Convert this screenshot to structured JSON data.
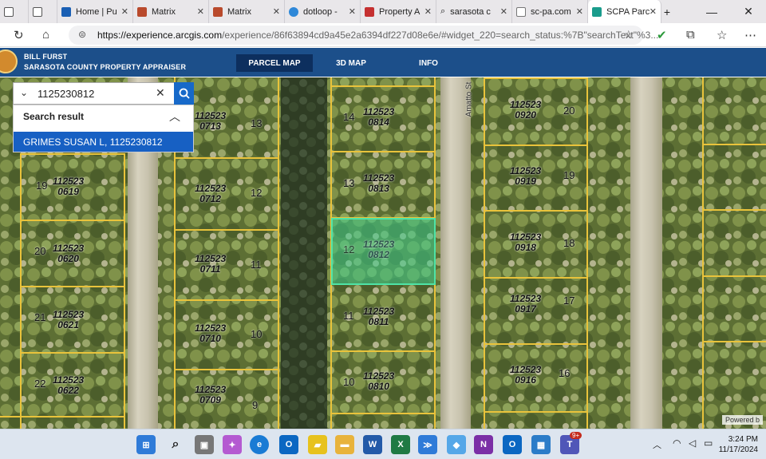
{
  "browser": {
    "tabs": [
      {
        "label": "",
        "color": "#6f6f6f"
      },
      {
        "label": "",
        "color": "#555"
      },
      {
        "label": "Home | Pu",
        "color": "#1a5fb4"
      },
      {
        "label": "Matrix",
        "color": "#b94a2c"
      },
      {
        "label": "Matrix",
        "color": "#b94a2c"
      },
      {
        "label": "dotloop - ",
        "color": "#2e88d8"
      },
      {
        "label": "Property A",
        "color": "#c53030"
      },
      {
        "label": "sarasota c",
        "color": "#555"
      },
      {
        "label": "sc-pa.com",
        "color": "#777"
      },
      {
        "label": "SCPA Parc",
        "color": "#1a9c8c"
      }
    ],
    "new_tab": "+",
    "url_domain": "https://experience.arcgis.com",
    "url_path": "/experience/86f63894cd9a45e2a6394df227d08e6e/#widget_220=search_status:%7B\"searchText\"%3..."
  },
  "header": {
    "org_line1": "BILL FURST",
    "org_line2": "SARASOTA COUNTY PROPERTY APPRAISER",
    "menu": [
      "PARCEL MAP",
      "3D MAP",
      "INFO"
    ]
  },
  "search": {
    "value": "1125230812",
    "results_title": "Search result",
    "result_item": "GRIMES SUSAN L, 1125230812"
  },
  "map": {
    "parcels": [
      {
        "id": "112523\n0713",
        "lot": "13"
      },
      {
        "id": "112523\n0712",
        "lot": "12"
      },
      {
        "id": "112523\n0711",
        "lot": "11"
      },
      {
        "id": "112523\n0710",
        "lot": "10"
      },
      {
        "id": "112523\n0709",
        "lot": "9"
      },
      {
        "id": "112523\n0619",
        "lot": "19"
      },
      {
        "id": "112523\n0620",
        "lot": "20"
      },
      {
        "id": "112523\n0621",
        "lot": "21"
      },
      {
        "id": "112523\n0622",
        "lot": "22"
      },
      {
        "id": "112523\n0814",
        "lot": "14"
      },
      {
        "id": "112523\n0813",
        "lot": "13"
      },
      {
        "id": "112523\n0812",
        "lot": "12"
      },
      {
        "id": "112523\n0811",
        "lot": "11"
      },
      {
        "id": "112523\n0810",
        "lot": "10"
      },
      {
        "id": "112523\n0920",
        "lot": "20"
      },
      {
        "id": "112523\n0919",
        "lot": "19"
      },
      {
        "id": "112523\n0918",
        "lot": "18"
      },
      {
        "id": "112523\n0917",
        "lot": "17"
      },
      {
        "id": "112523\n0916",
        "lot": "16"
      }
    ],
    "street_label": "Amatto St",
    "powered_by": "Powered b"
  },
  "taskbar": {
    "time": "3:24 PM",
    "date": "11/17/2024",
    "badge": "9+"
  }
}
